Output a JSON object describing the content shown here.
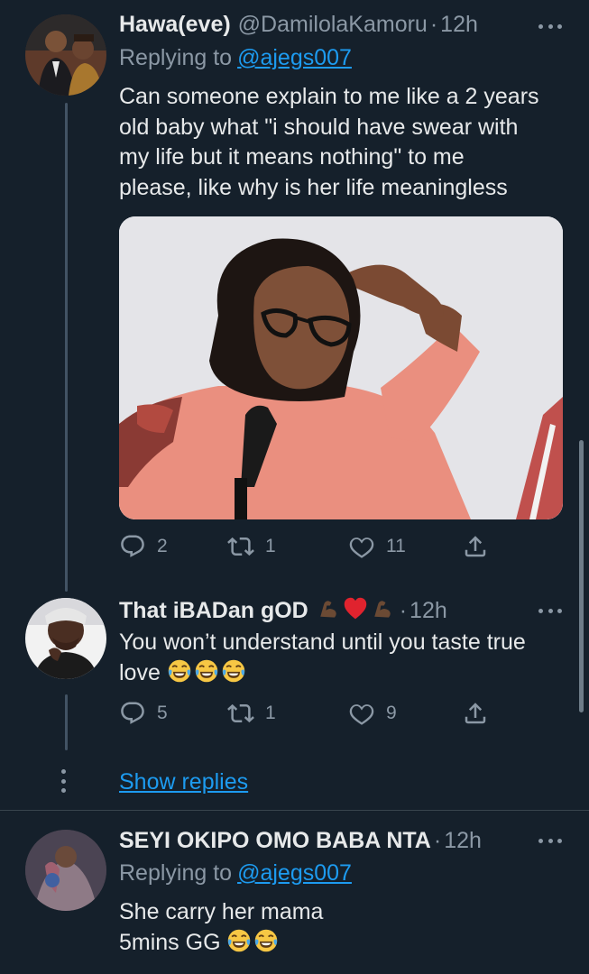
{
  "tweets": [
    {
      "name": "Hawa(eve)",
      "handle": "@DamilolaKamoru",
      "time": "12h",
      "replying_prefix": "Replying to",
      "replying_to": "@ajegs007",
      "text": "Can someone explain to me like a 2 years\nold baby what \"i should have swear with\nmy life but it means nothing\" to me\nplease, like why is her life meaningless",
      "replies": "2",
      "retweets": "1",
      "likes": "11"
    },
    {
      "name": "That iBADan gOD",
      "name_emojis": [
        "flexed-biceps",
        "red-heart",
        "flexed-biceps"
      ],
      "time": "12h",
      "text": "You won’t understand until you taste true\nlove ",
      "text_emojis": [
        "face-with-tears-of-joy",
        "face-with-tears-of-joy",
        "face-with-tears-of-joy"
      ],
      "replies": "5",
      "retweets": "1",
      "likes": "9"
    },
    {
      "name": "SEYI OKIPO OMO BABA NTA",
      "time": "12h",
      "replying_prefix": "Replying to",
      "replying_to": "@ajegs007",
      "text": "She carry her mama\n5mins GG ",
      "text_emojis": [
        "face-with-tears-of-joy",
        "face-with-tears-of-joy"
      ]
    }
  ],
  "show_replies": "Show replies",
  "dot": "·",
  "colors": {
    "background": "#15202b",
    "text": "#e7e9ea",
    "secondary": "#8b98a5",
    "link": "#1d9bf0",
    "divider": "#38444d"
  },
  "icons": [
    "reply-icon",
    "retweet-icon",
    "like-icon",
    "share-icon",
    "more-icon"
  ]
}
